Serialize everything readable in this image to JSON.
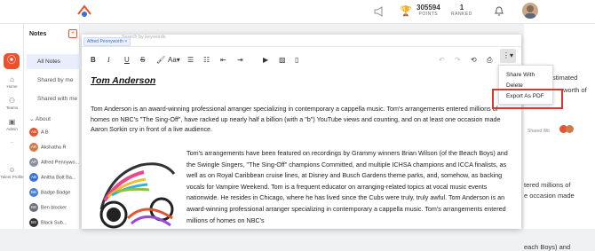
{
  "topbar": {
    "points_value": "305594",
    "points_label": "POINTS",
    "ranked_value": "1",
    "ranked_label": "RANKED"
  },
  "leftnav": {
    "items": [
      {
        "label": "Home",
        "icon": "home-icon"
      },
      {
        "label": "Teams",
        "icon": "teams-icon"
      },
      {
        "label": "Admin",
        "icon": "admin-icon"
      },
      {
        "label": "...",
        "icon": "more-icon"
      },
      {
        "label": "Talent Profile",
        "icon": "profile-icon"
      }
    ]
  },
  "sidebar": {
    "title": "Notes",
    "add_label": "+",
    "items": [
      "All Notes",
      "Shared by me",
      "Shared with me"
    ],
    "section": "About",
    "people": [
      {
        "initials": "AB",
        "name": "A B",
        "color": "#e8532f"
      },
      {
        "initials": "AR",
        "name": "Akshatha R",
        "color": "#d07a4a"
      },
      {
        "initials": "AP",
        "name": "Alfred Pennywo...",
        "color": "#8a8fa0"
      },
      {
        "initials": "AB",
        "name": "Anitha Bolt Ba...",
        "color": "#3b6fd6"
      },
      {
        "initials": "BB",
        "name": "Badge Badge",
        "color": "#4a7dd6"
      },
      {
        "initials": "BB",
        "name": "Ben blocker",
        "color": "#6a6f7a"
      },
      {
        "initials": "BS",
        "name": "Black Sub...",
        "color": "#333"
      }
    ]
  },
  "editor": {
    "search_placeholder": "Search by keywords",
    "chip_label": "Alfred Pennyworth",
    "chip_close": "×",
    "toolbar": {
      "bold": "B",
      "italic": "I",
      "underline": "U",
      "strike": "S",
      "text_size": "Aa",
      "font_case": "Aa"
    },
    "title": "Tom Anderson",
    "paragraph1": "Tom Anderson is an award-winning professional arranger specializing in contemporary a cappella music. Tom's arrangements entered millions of homes on NBC's \"The Sing-Off\", have racked up nearly half a billion (with a \"b\") YouTube views and counting, and on at least one occasion made Aaron Sorkin cry in front of a live audience.",
    "paragraph2": "Tom's arrangements have been featured on recordings by Grammy winners Brian Wilson (of the Beach Boys) and the Swingle Singers, \"The Sing-Off\" champions Committed, and multiple ICHSA champions and ICCA finalists, as well as on Royal Caribbean cruise lines, at Disney and Busch Gardens theme parks, and, somehow, as backing vocals for Vampire Weekend. Tom is a frequent educator on arranging-related topics at vocal music events nationwide. He resides in Chicago, where he has lived since the Cubs were truly, truly awful. Tom Anderson is an award-winning professional arranger specializing in contemporary a cappella music. Tom's arrangements entered millions of homes on NBC's"
  },
  "menu": {
    "items": [
      "Share With",
      "Delete",
      "Export As PDF"
    ]
  },
  "background_right": {
    "line1": "stimated",
    "line2": "worth of",
    "line3": "tered millions of",
    "line4": "e occasion made",
    "line5": "each Boys) and",
    "shared_label": "Shared Wit"
  }
}
